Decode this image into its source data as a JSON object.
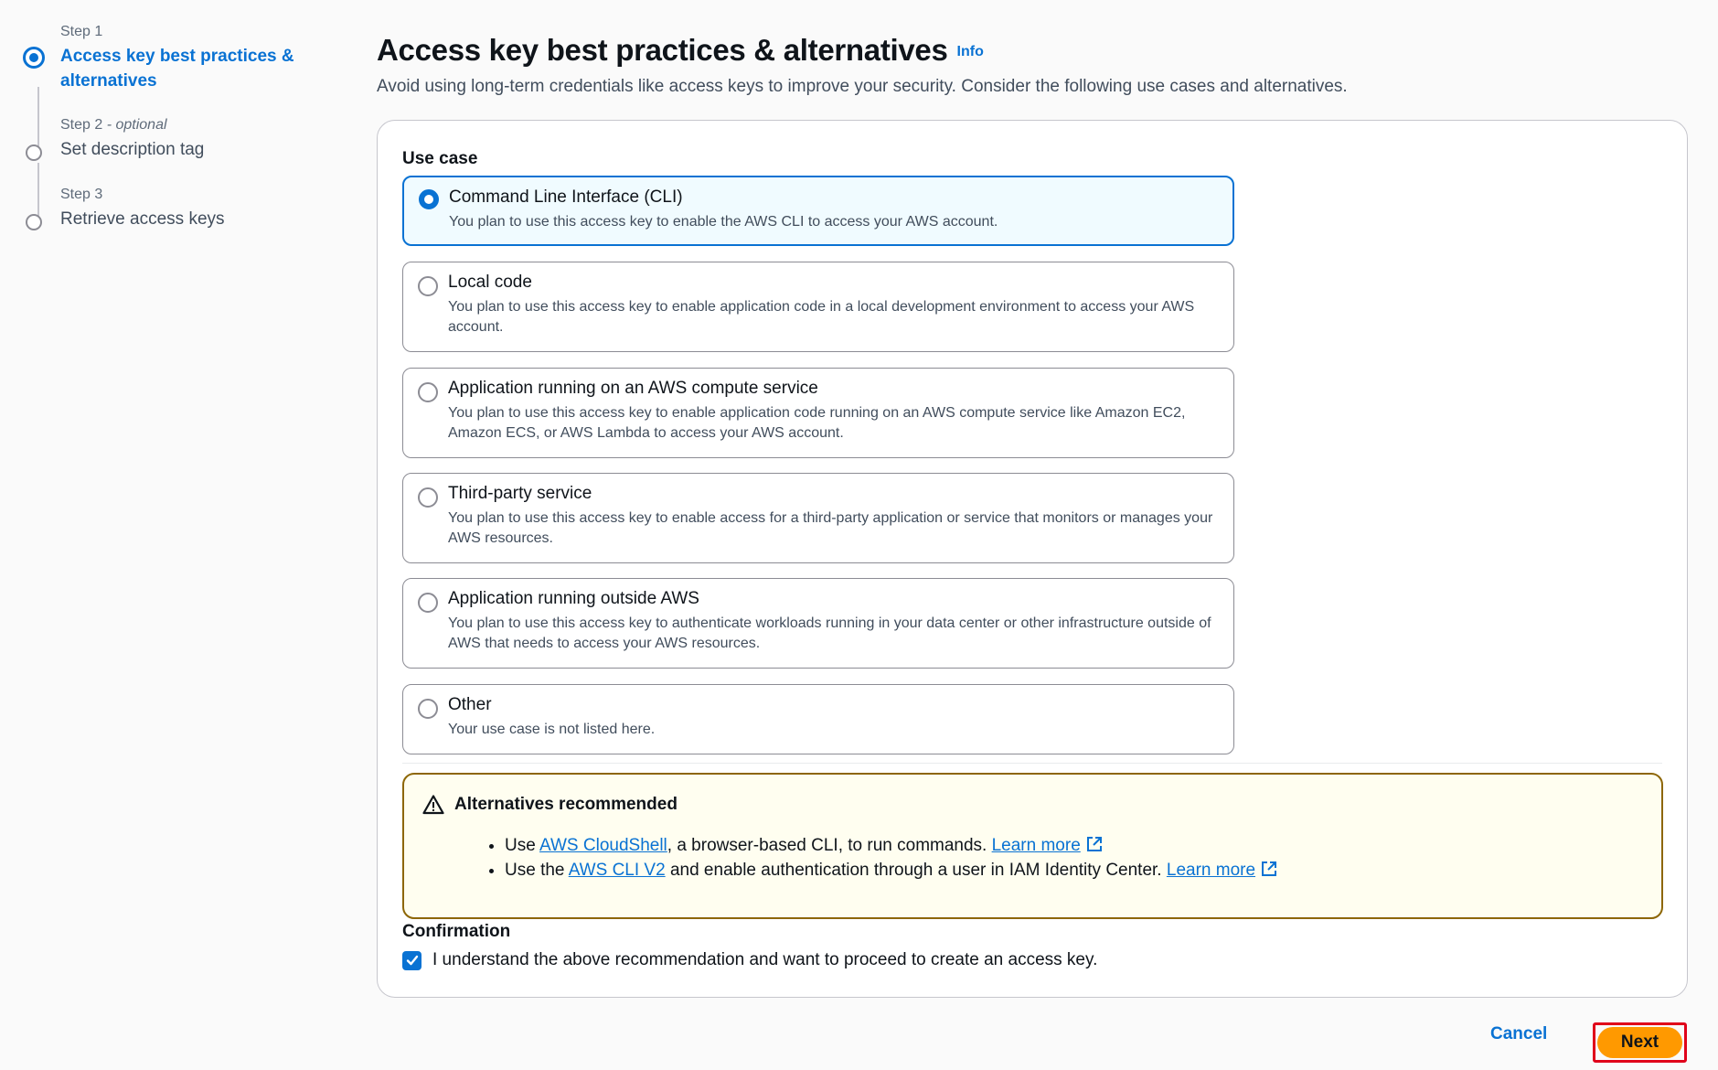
{
  "steps": [
    {
      "num": "Step 1",
      "optional": "",
      "title": "Access key best practices & alternatives"
    },
    {
      "num": "Step 2",
      "optional": " - optional",
      "title": "Set description tag"
    },
    {
      "num": "Step 3",
      "optional": "",
      "title": "Retrieve access keys"
    }
  ],
  "header": {
    "title": "Access key best practices & alternatives",
    "info": "Info",
    "description": "Avoid using long-term credentials like access keys to improve your security. Consider the following use cases and alternatives."
  },
  "use_case": {
    "label": "Use case",
    "selected_index": 0,
    "options": [
      {
        "title": "Command Line Interface (CLI)",
        "desc": "You plan to use this access key to enable the AWS CLI to access your AWS account."
      },
      {
        "title": "Local code",
        "desc": "You plan to use this access key to enable application code in a local development environment to access your AWS account."
      },
      {
        "title": "Application running on an AWS compute service",
        "desc": "You plan to use this access key to enable application code running on an AWS compute service like Amazon EC2, Amazon ECS, or AWS Lambda to access your AWS account."
      },
      {
        "title": "Third-party service",
        "desc": "You plan to use this access key to enable access for a third-party application or service that monitors or manages your AWS resources."
      },
      {
        "title": "Application running outside AWS",
        "desc": "You plan to use this access key to authenticate workloads running in your data center or other infrastructure outside of AWS that needs to access your AWS resources."
      },
      {
        "title": "Other",
        "desc": "Your use case is not listed here."
      }
    ]
  },
  "alert": {
    "title": "Alternatives recommended",
    "items": [
      {
        "prefix": "Use ",
        "link": "AWS CloudShell",
        "suffix": ", a browser-based CLI, to run commands. ",
        "learn": "Learn more"
      },
      {
        "prefix": "Use the ",
        "link": "AWS CLI V2",
        "suffix": " and enable authentication through a user in IAM Identity Center. ",
        "learn": "Learn more"
      }
    ]
  },
  "confirmation": {
    "label": "Confirmation",
    "text": "I understand the above recommendation and want to proceed to create an access key.",
    "checked": true
  },
  "footer": {
    "cancel": "Cancel",
    "next": "Next"
  },
  "colors": {
    "accent": "#0972d3",
    "primary_button": "#ff9900",
    "warning_border": "#8d6605",
    "highlight": "#e0001a"
  }
}
